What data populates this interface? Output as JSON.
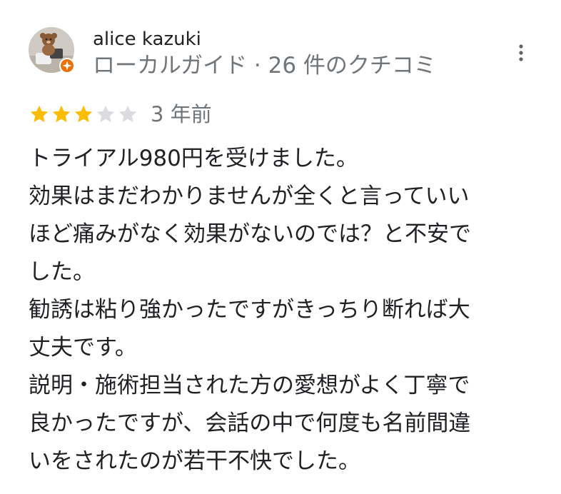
{
  "reviewer": {
    "name": "alice kazuki",
    "meta": "ローカルガイド · 26 件のクチコミ",
    "avatar": "avatar-photo",
    "badge_icon": "local-guide-badge-icon"
  },
  "review": {
    "rating": 3,
    "max_rating": 5,
    "date": "3 年前",
    "lines": [
      "トライアル980円を受けました。",
      "効果はまだわかりませんが全くと言っていい",
      "ほど痛みがなく効果がないのでは？と不安で",
      "した。",
      "勧誘は粘り強かったですがきっちり断れば大",
      "丈夫です。",
      "説明・施術担当された方の愛想がよく丁寧で",
      "良かったですが、会話の中で何度も名前間違",
      "いをされたのが若干不快でした。"
    ]
  },
  "actions": {
    "more_icon": "more-vert-icon"
  },
  "colors": {
    "star_filled": "#fbbc04",
    "star_empty": "#dadce0",
    "text_primary": "#202124",
    "text_secondary": "#70757a",
    "badge_orange": "#e8710a"
  }
}
